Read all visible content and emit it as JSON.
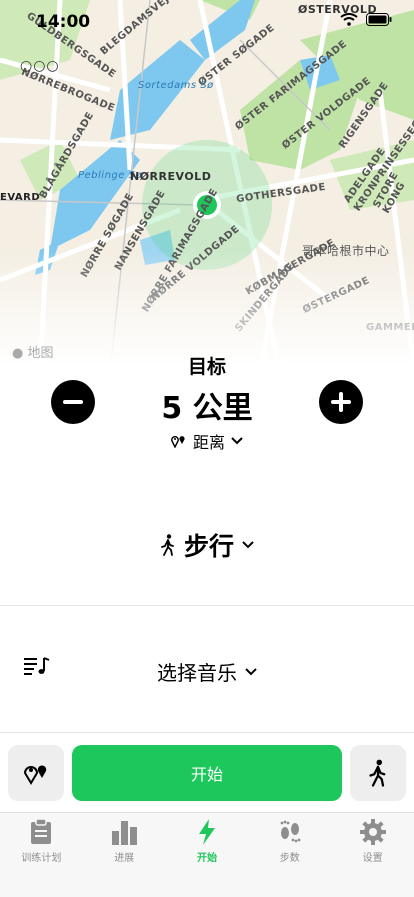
{
  "status_bar": {
    "time": "14:00"
  },
  "map": {
    "labels": {
      "osterovoldtop": "ØSTERVOLD",
      "blegdamsvej": "BLEGDAMSVEJ",
      "oster_sogade": "ØSTER SØGADE",
      "oster_farimag": "ØSTER FARIMAGSGADE",
      "oster_voldgade": "ØSTER VOLDGADE",
      "sortedams": "Sortedams Sø",
      "noerrebrogade": "NØRREBROGADE",
      "blaagaardsgade": "BLÅGÅRDSGADE",
      "guldbergsgade": "GULDBERGSGADE",
      "peblinge": "Peblinge Sø",
      "noerrevold": "NØRREVOLD",
      "gothersgade": "GOTHERSGADE",
      "kronprinsessegade": "KRONPRINSESSEGADE",
      "rigensgade": "RIGENSGADE",
      "adelgade": "ADELGADE",
      "store_kongensgade": "STORE KONG",
      "nansensgade": "NANSENSGADE",
      "noerre_farimag": "NØRRE FARIMAGSGADE",
      "noerre_soegade": "NØRRE SØGADE",
      "noerre_voldgade": "NØRRE VOLDGADE",
      "koebmagergade": "KØBMAGERGADE",
      "oestergade": "ØSTERGADE",
      "skindergade": "SKINDERGADE",
      "copenhagen_center": "哥本哈根市中心",
      "gammel": "GAMMELH",
      "evard": "EVARD",
      "attribution": "地图"
    }
  },
  "goal": {
    "title": "目标",
    "value": "5 公里",
    "metric": "距离"
  },
  "activity": {
    "label": "步行"
  },
  "music": {
    "label": "选择音乐"
  },
  "start_button": {
    "label": "开始"
  },
  "tabs": [
    {
      "label": "训练计划",
      "icon": "clipboard-icon",
      "active": false
    },
    {
      "label": "进展",
      "icon": "bar-chart-icon",
      "active": false
    },
    {
      "label": "开始",
      "icon": "lightning-icon",
      "active": true
    },
    {
      "label": "步数",
      "icon": "footprints-icon",
      "active": false
    },
    {
      "label": "设置",
      "icon": "gear-icon",
      "active": false
    }
  ],
  "colors": {
    "accent": "#1ec75c",
    "water": "#7ec8f0",
    "park": "#bfe3a5",
    "road": "#ffffff",
    "land": "#f4eee3"
  }
}
